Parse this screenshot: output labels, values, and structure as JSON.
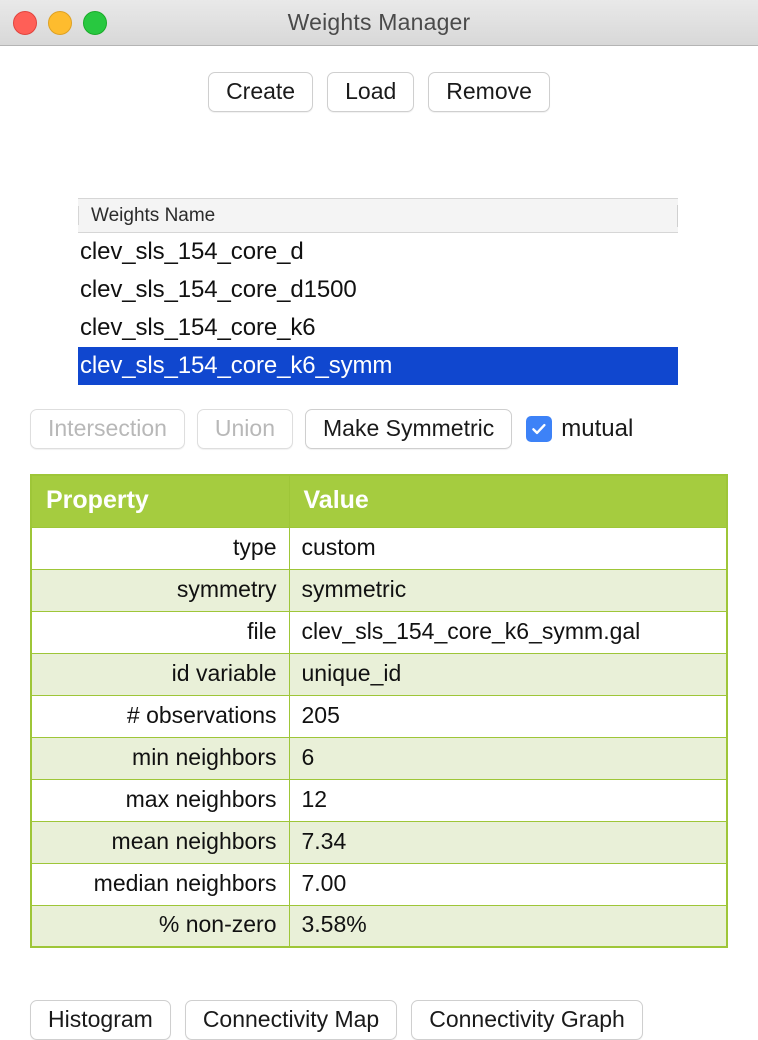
{
  "window": {
    "title": "Weights Manager",
    "traffic_lights": [
      {
        "name": "close",
        "color": "#ff5f57"
      },
      {
        "name": "minimize",
        "color": "#febc2e"
      },
      {
        "name": "maximize",
        "color": "#28c840"
      }
    ]
  },
  "toolbar": {
    "create_label": "Create",
    "load_label": "Load",
    "remove_label": "Remove"
  },
  "weights_list": {
    "column_header": "Weights Name",
    "items": [
      {
        "name": "clev_sls_154_core_d",
        "selected": false
      },
      {
        "name": "clev_sls_154_core_d1500",
        "selected": false
      },
      {
        "name": "clev_sls_154_core_k6",
        "selected": false
      },
      {
        "name": "clev_sls_154_core_k6_symm",
        "selected": true
      }
    ],
    "selected_index": 3,
    "selection_color": "#1047cf"
  },
  "operations": {
    "intersection_label": "Intersection",
    "intersection_enabled": false,
    "union_label": "Union",
    "union_enabled": false,
    "make_symmetric_label": "Make Symmetric",
    "make_symmetric_enabled": true,
    "mutual_label": "mutual",
    "mutual_checked": true,
    "checkbox_color": "#3d82f7"
  },
  "properties": {
    "header": {
      "property": "Property",
      "value": "Value"
    },
    "header_bg": "#a5cc3f",
    "row_alt_bg": "#e9f0d8",
    "border_color": "#9ec638",
    "rows": [
      {
        "property": "type",
        "value": "custom"
      },
      {
        "property": "symmetry",
        "value": "symmetric"
      },
      {
        "property": "file",
        "value": "clev_sls_154_core_k6_symm.gal"
      },
      {
        "property": "id variable",
        "value": "unique_id"
      },
      {
        "property": "# observations",
        "value": "205"
      },
      {
        "property": "min neighbors",
        "value": "6"
      },
      {
        "property": "max neighbors",
        "value": "12"
      },
      {
        "property": "mean neighbors",
        "value": "7.34"
      },
      {
        "property": "median neighbors",
        "value": "7.00"
      },
      {
        "property": "% non-zero",
        "value": "3.58%"
      }
    ]
  },
  "footer": {
    "histogram_label": "Histogram",
    "connectivity_map_label": "Connectivity Map",
    "connectivity_graph_label": "Connectivity Graph"
  }
}
